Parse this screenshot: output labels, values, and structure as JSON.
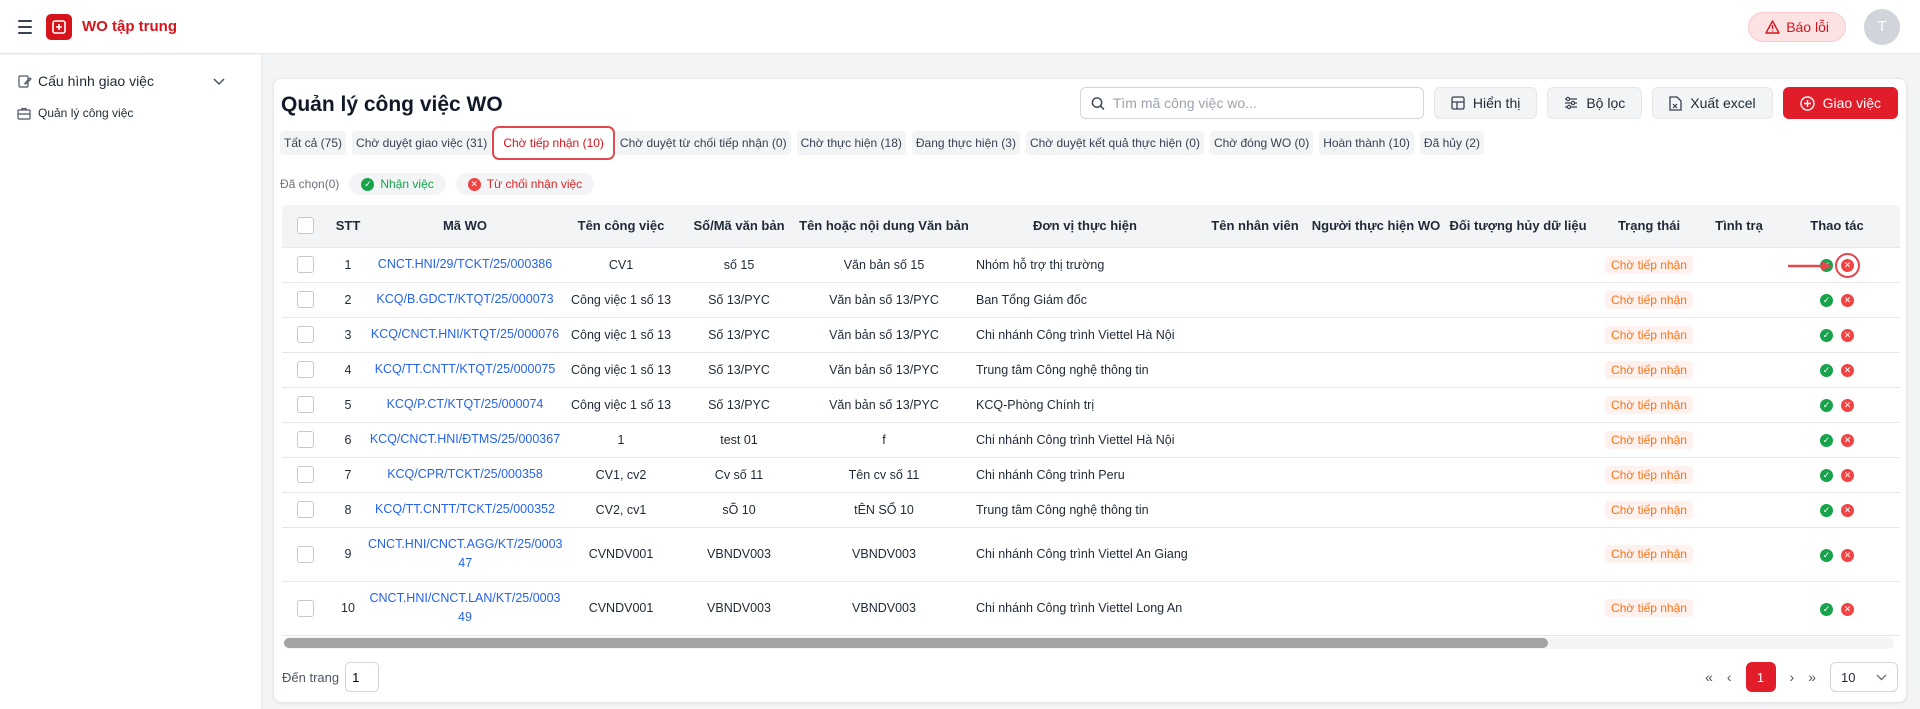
{
  "header": {
    "app_title": "WO tập trung",
    "bug_label": "Báo lỗi",
    "avatar_initial": "T"
  },
  "sidebar": {
    "group_label": "Cấu hình giao việc",
    "sub_label": "Quản lý công việc"
  },
  "main": {
    "title": "Quản lý công việc WO",
    "search_placeholder": "Tìm mã công việc wo...",
    "buttons": {
      "display": "Hiển thị",
      "filter": "Bộ lọc",
      "export": "Xuất excel",
      "assign": "Giao việc"
    },
    "tabs": [
      "Tất cả (75)",
      "Chờ duyệt giao việc (31)",
      "Chờ tiếp nhận (10)",
      "Chờ duyệt từ chối tiếp nhận (0)",
      "Chờ thực hiện (18)",
      "Đang thực hiện (3)",
      "Chờ duyệt kết quả thực hiện (0)",
      "Chờ đóng WO (0)",
      "Hoàn thành (10)",
      "Đã hủy (2)"
    ],
    "active_tab": 2,
    "selected_label": "Đã chọn(0)",
    "accept_label": "Nhận việc",
    "reject_label": "Từ chối nhận việc"
  },
  "table": {
    "columns": [
      "",
      "STT",
      "Mã WO",
      "Tên công việc",
      "Số/Mã văn bản",
      "Tên hoặc nội dung Văn bản",
      "Đơn vị thực hiện",
      "Tên nhân viên",
      "Người thực hiện WO",
      "Đối tượng hủy dữ liệu",
      "Trạng thái",
      "Tình trạ",
      "Thao tác"
    ],
    "rows": [
      {
        "stt": "1",
        "wo": "CNCT.HNI/29/TCKT/25/000386",
        "name": "CV1",
        "doc_no": "số 15",
        "doc_name": "Văn bản số 15",
        "unit": "Nhóm hỗ trợ thị trường",
        "status": "Chờ tiếp nhận"
      },
      {
        "stt": "2",
        "wo": "KCQ/B.GDCT/KTQT/25/000073",
        "name": "Công việc 1 số 13",
        "doc_no": "Số 13/PYC",
        "doc_name": "Văn bản số 13/PYC",
        "unit": "Ban Tổng Giám đốc",
        "status": "Chờ tiếp nhận"
      },
      {
        "stt": "3",
        "wo": "KCQ/CNCT.HNI/KTQT/25/000076",
        "name": "Công việc 1 số 13",
        "doc_no": "Số 13/PYC",
        "doc_name": "Văn bản số 13/PYC",
        "unit": "Chi nhánh Công trình Viettel Hà Nội",
        "status": "Chờ tiếp nhận"
      },
      {
        "stt": "4",
        "wo": "KCQ/TT.CNTT/KTQT/25/000075",
        "name": "Công việc 1 số 13",
        "doc_no": "Số 13/PYC",
        "doc_name": "Văn bản số 13/PYC",
        "unit": "Trung tâm Công nghệ thông tin",
        "status": "Chờ tiếp nhận"
      },
      {
        "stt": "5",
        "wo": "KCQ/P.CT/KTQT/25/000074",
        "name": "Công việc 1 số 13",
        "doc_no": "Số 13/PYC",
        "doc_name": "Văn bản số 13/PYC",
        "unit": "KCQ-Phòng Chính trị",
        "status": "Chờ tiếp nhận"
      },
      {
        "stt": "6",
        "wo": "KCQ/CNCT.HNI/ĐTMS/25/000367",
        "name": "1",
        "doc_no": "test 01",
        "doc_name": "f",
        "unit": "Chi nhánh Công trình Viettel Hà Nội",
        "status": "Chờ tiếp nhận"
      },
      {
        "stt": "7",
        "wo": "KCQ/CPR/TCKT/25/000358",
        "name": "CV1, cv2",
        "doc_no": "Cv số 11",
        "doc_name": "Tên cv số 11",
        "unit": "Chi nhánh Công trình Peru",
        "status": "Chờ tiếp nhận"
      },
      {
        "stt": "8",
        "wo": "KCQ/TT.CNTT/TCKT/25/000352",
        "name": "CV2, cv1",
        "doc_no": "sÕ 10",
        "doc_name": "tÊN SỐ 10",
        "unit": "Trung tâm Công nghệ thông tin",
        "status": "Chờ tiếp nhận"
      },
      {
        "stt": "9",
        "wo": "CNCT.HNI/CNCT.AGG/KT/25/000347",
        "wo_line1": "CNCT.HNI/CNCT.AGG/KT/25/0003",
        "wo_line2": "47",
        "name": "CVNDV001",
        "doc_no": "VBNDV003",
        "doc_name": "VBNDV003",
        "unit": "Chi nhánh Công trình Viettel An Giang",
        "status": "Chờ tiếp nhận"
      },
      {
        "stt": "10",
        "wo": "CNCT.HNI/CNCT.LAN/KT/25/000349",
        "wo_line1": "CNCT.HNI/CNCT.LAN/KT/25/0003",
        "wo_line2": "49",
        "name": "CVNDV001",
        "doc_no": "VBNDV003",
        "doc_name": "VBNDV003",
        "unit": "Chi nhánh Công trình Viettel Long An",
        "status": "Chờ tiếp nhận"
      }
    ]
  },
  "pager": {
    "goto_label": "Đến trang",
    "goto_value": "1",
    "first": "«",
    "prev": "‹",
    "current": "1",
    "next": "›",
    "last": "»",
    "page_size": "10"
  },
  "colors": {
    "brand": "#d7141c",
    "primary_button": "#e11d2a",
    "link": "#2563eb",
    "status_text": "#f97316",
    "accept": "#16a34a",
    "reject": "#ef4444"
  },
  "icons": {
    "menu": "hamburger-icon",
    "bug": "warning-triangle-icon",
    "search": "search-icon",
    "display": "grid-icon",
    "filter": "sliders-icon",
    "export": "excel-file-icon",
    "assign": "plus-circle-icon",
    "accept": "check-circle-icon",
    "reject": "x-circle-icon"
  }
}
